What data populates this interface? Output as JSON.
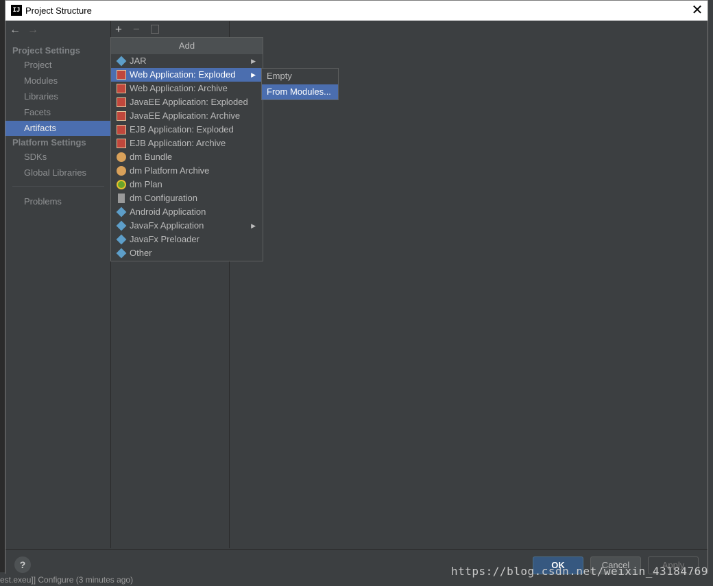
{
  "window": {
    "title": "Project Structure",
    "app_icon_text": "IJ"
  },
  "sidebar": {
    "project_settings": "Project Settings",
    "platform_settings": "Platform Settings",
    "items": [
      "Project",
      "Modules",
      "Libraries",
      "Facets",
      "Artifacts"
    ],
    "platform_items": [
      "SDKs",
      "Global Libraries"
    ],
    "problems": "Problems",
    "selected": "Artifacts"
  },
  "toolbar": {
    "add": "+",
    "remove": "−"
  },
  "popup": {
    "title": "Add",
    "items": [
      {
        "label": "JAR",
        "icon": "jar-icon",
        "submenu": true
      },
      {
        "label": "Web Application: Exploded",
        "icon": "web-app-icon",
        "submenu": true,
        "selected": true
      },
      {
        "label": "Web Application: Archive",
        "icon": "web-app-icon"
      },
      {
        "label": "JavaEE Application: Exploded",
        "icon": "javaee-icon"
      },
      {
        "label": "JavaEE Application: Archive",
        "icon": "javaee-icon"
      },
      {
        "label": "EJB Application: Exploded",
        "icon": "ejb-icon"
      },
      {
        "label": "EJB Application: Archive",
        "icon": "ejb-icon"
      },
      {
        "label": "dm Bundle",
        "icon": "dm-bundle-icon"
      },
      {
        "label": "dm Platform Archive",
        "icon": "dm-platform-icon"
      },
      {
        "label": "dm Plan",
        "icon": "dm-plan-icon"
      },
      {
        "label": "dm Configuration",
        "icon": "dm-config-icon"
      },
      {
        "label": "Android Application",
        "icon": "android-icon"
      },
      {
        "label": "JavaFx Application",
        "icon": "javafx-icon",
        "submenu": true
      },
      {
        "label": "JavaFx Preloader",
        "icon": "javafx-icon"
      },
      {
        "label": "Other",
        "icon": "other-icon"
      }
    ]
  },
  "submenu": {
    "items": [
      "Empty",
      "From Modules..."
    ],
    "selected": "From Modules..."
  },
  "buttons": {
    "help": "?",
    "ok": "OK",
    "cancel": "Cancel",
    "apply": "Apply"
  },
  "watermark": "https://blog.csdn.net/weixin_43184769",
  "status_line": "est.exeu]]   Configure (3 minutes ago)",
  "colors": {
    "background": "#3c3f41",
    "selection": "#4b6eaf",
    "ok_button": "#365880"
  }
}
